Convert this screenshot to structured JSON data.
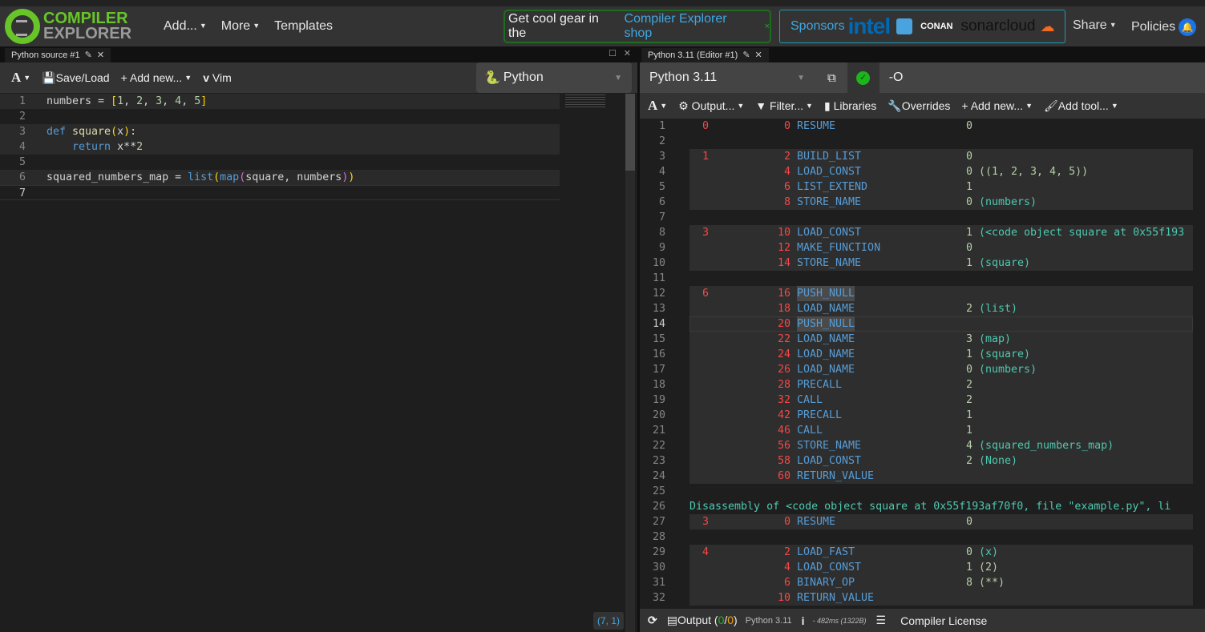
{
  "nav": {
    "logo_line1": "COMPILER",
    "logo_line2": "EXPLORER",
    "add": "Add...",
    "more": "More",
    "templates": "Templates",
    "shop_text": "Get cool gear in the",
    "shop_link": "Compiler Explorer shop",
    "shop_close": "×",
    "sponsors": "Sponsors",
    "sponsor_intel": "intel",
    "sponsor_conan": "CONAN",
    "sponsor_sonar": "sonarcloud",
    "share": "Share",
    "policies": "Policies"
  },
  "editor": {
    "tab": "Python source #1",
    "font_btn": "A",
    "save_load": "Save/Load",
    "add_new": "Add new...",
    "vim": "Vim",
    "language": "Python",
    "cursor_pos": "(7, 1)",
    "lines": [
      {
        "n": "1",
        "html": [
          [
            "t",
            "numbers = "
          ],
          [
            "p",
            "["
          ],
          [
            "n",
            "1"
          ],
          [
            "t",
            ", "
          ],
          [
            "n",
            "2"
          ],
          [
            "t",
            ", "
          ],
          [
            "n",
            "3"
          ],
          [
            "t",
            ", "
          ],
          [
            "n",
            "4"
          ],
          [
            "t",
            ", "
          ],
          [
            "n",
            "5"
          ],
          [
            "p",
            "]"
          ]
        ]
      },
      {
        "n": "2",
        "html": []
      },
      {
        "n": "3",
        "html": [
          [
            "k",
            "def "
          ],
          [
            "f",
            "square"
          ],
          [
            "p",
            "("
          ],
          [
            "t",
            "x"
          ],
          [
            "p",
            ")"
          ],
          [
            "t",
            ":"
          ]
        ]
      },
      {
        "n": "4",
        "html": [
          [
            "t",
            "    "
          ],
          [
            "k",
            "return "
          ],
          [
            "t",
            "x**"
          ],
          [
            "n",
            "2"
          ]
        ]
      },
      {
        "n": "5",
        "html": []
      },
      {
        "n": "6",
        "html": [
          [
            "t",
            "squared_numbers_map = "
          ],
          [
            "k",
            "list"
          ],
          [
            "p",
            "("
          ],
          [
            "k",
            "map"
          ],
          [
            "pp",
            "("
          ],
          [
            "t",
            "square, numbers"
          ],
          [
            "pp",
            ")"
          ],
          [
            "p",
            ")"
          ]
        ]
      },
      {
        "n": "7",
        "html": []
      }
    ]
  },
  "compiler": {
    "tab": "Python 3.11 (Editor #1)",
    "name": "Python 3.11",
    "options": "-O",
    "font_btn": "A",
    "output": "Output...",
    "filter": "Filter...",
    "libraries": "Libraries",
    "overrides": "Overrides",
    "add_new": "Add new...",
    "add_tool": "Add tool...",
    "asm": [
      {
        "n": "1",
        "src": "0",
        "addr": "0",
        "op": "RESUME",
        "arg": "0",
        "c": "",
        "b": false
      },
      {
        "n": "2",
        "src": "",
        "addr": "",
        "op": "",
        "arg": "",
        "c": "",
        "b": false
      },
      {
        "n": "3",
        "src": "1",
        "addr": "2",
        "op": "BUILD_LIST",
        "arg": "0",
        "c": "",
        "b": true
      },
      {
        "n": "4",
        "src": "",
        "addr": "4",
        "op": "LOAD_CONST",
        "arg": "0",
        "c": "((1, 2, 3, 4, 5))",
        "b": true
      },
      {
        "n": "5",
        "src": "",
        "addr": "6",
        "op": "LIST_EXTEND",
        "arg": "1",
        "c": "",
        "b": true
      },
      {
        "n": "6",
        "src": "",
        "addr": "8",
        "op": "STORE_NAME",
        "arg": "0",
        "c": "(numbers)",
        "b": true
      },
      {
        "n": "7",
        "src": "",
        "addr": "",
        "op": "",
        "arg": "",
        "c": "",
        "b": false
      },
      {
        "n": "8",
        "src": "3",
        "addr": "10",
        "op": "LOAD_CONST",
        "arg": "1",
        "c": "(<code object square at 0x55f193",
        "b": true
      },
      {
        "n": "9",
        "src": "",
        "addr": "12",
        "op": "MAKE_FUNCTION",
        "arg": "0",
        "c": "",
        "b": true
      },
      {
        "n": "10",
        "src": "",
        "addr": "14",
        "op": "STORE_NAME",
        "arg": "1",
        "c": "(square)",
        "b": true
      },
      {
        "n": "11",
        "src": "",
        "addr": "",
        "op": "",
        "arg": "",
        "c": "",
        "b": false
      },
      {
        "n": "12",
        "src": "6",
        "addr": "16",
        "op": "PUSH_NULL",
        "arg": "",
        "c": "",
        "b": true
      },
      {
        "n": "13",
        "src": "",
        "addr": "18",
        "op": "LOAD_NAME",
        "arg": "2",
        "c": "(list)",
        "b": true
      },
      {
        "n": "14",
        "src": "",
        "addr": "20",
        "op": "PUSH_NULL",
        "arg": "",
        "c": "",
        "b": true
      },
      {
        "n": "15",
        "src": "",
        "addr": "22",
        "op": "LOAD_NAME",
        "arg": "3",
        "c": "(map)",
        "b": true
      },
      {
        "n": "16",
        "src": "",
        "addr": "24",
        "op": "LOAD_NAME",
        "arg": "1",
        "c": "(square)",
        "b": true
      },
      {
        "n": "17",
        "src": "",
        "addr": "26",
        "op": "LOAD_NAME",
        "arg": "0",
        "c": "(numbers)",
        "b": true
      },
      {
        "n": "18",
        "src": "",
        "addr": "28",
        "op": "PRECALL",
        "arg": "2",
        "c": "",
        "b": true
      },
      {
        "n": "19",
        "src": "",
        "addr": "32",
        "op": "CALL",
        "arg": "2",
        "c": "",
        "b": true
      },
      {
        "n": "20",
        "src": "",
        "addr": "42",
        "op": "PRECALL",
        "arg": "1",
        "c": "",
        "b": true
      },
      {
        "n": "21",
        "src": "",
        "addr": "46",
        "op": "CALL",
        "arg": "1",
        "c": "",
        "b": true
      },
      {
        "n": "22",
        "src": "",
        "addr": "56",
        "op": "STORE_NAME",
        "arg": "4",
        "c": "(squared_numbers_map)",
        "b": true
      },
      {
        "n": "23",
        "src": "",
        "addr": "58",
        "op": "LOAD_CONST",
        "arg": "2",
        "c": "(None)",
        "b": true
      },
      {
        "n": "24",
        "src": "",
        "addr": "60",
        "op": "RETURN_VALUE",
        "arg": "",
        "c": "",
        "b": true
      },
      {
        "n": "25",
        "src": "",
        "addr": "",
        "op": "",
        "arg": "",
        "c": "",
        "b": false
      },
      {
        "n": "26",
        "text": "Disassembly of <code object square at 0x55f193af70f0, file \"example.py\", li"
      },
      {
        "n": "27",
        "src": "3",
        "addr": "0",
        "op": "RESUME",
        "arg": "0",
        "c": "",
        "b": true
      },
      {
        "n": "28",
        "src": "",
        "addr": "",
        "op": "",
        "arg": "",
        "c": "",
        "b": false
      },
      {
        "n": "29",
        "src": "4",
        "addr": "2",
        "op": "LOAD_FAST",
        "arg": "0",
        "c": "(x)",
        "b": true
      },
      {
        "n": "30",
        "src": "",
        "addr": "4",
        "op": "LOAD_CONST",
        "arg": "1",
        "c": "(2)",
        "b": true
      },
      {
        "n": "31",
        "src": "",
        "addr": "6",
        "op": "BINARY_OP",
        "arg": "8",
        "c": "(**)",
        "b": true
      },
      {
        "n": "32",
        "src": "",
        "addr": "10",
        "op": "RETURN_VALUE",
        "arg": "",
        "c": "",
        "b": true
      }
    ]
  },
  "status": {
    "output": "Output (",
    "ok": "0",
    "sep": "/",
    "warn": "0",
    "close": ")",
    "compiler": "Python 3.11",
    "timing": "- 482ms (1322B)",
    "license": "Compiler License"
  },
  "colors": {
    "accent_green": "#67c52a",
    "link": "#3fa7e0"
  }
}
